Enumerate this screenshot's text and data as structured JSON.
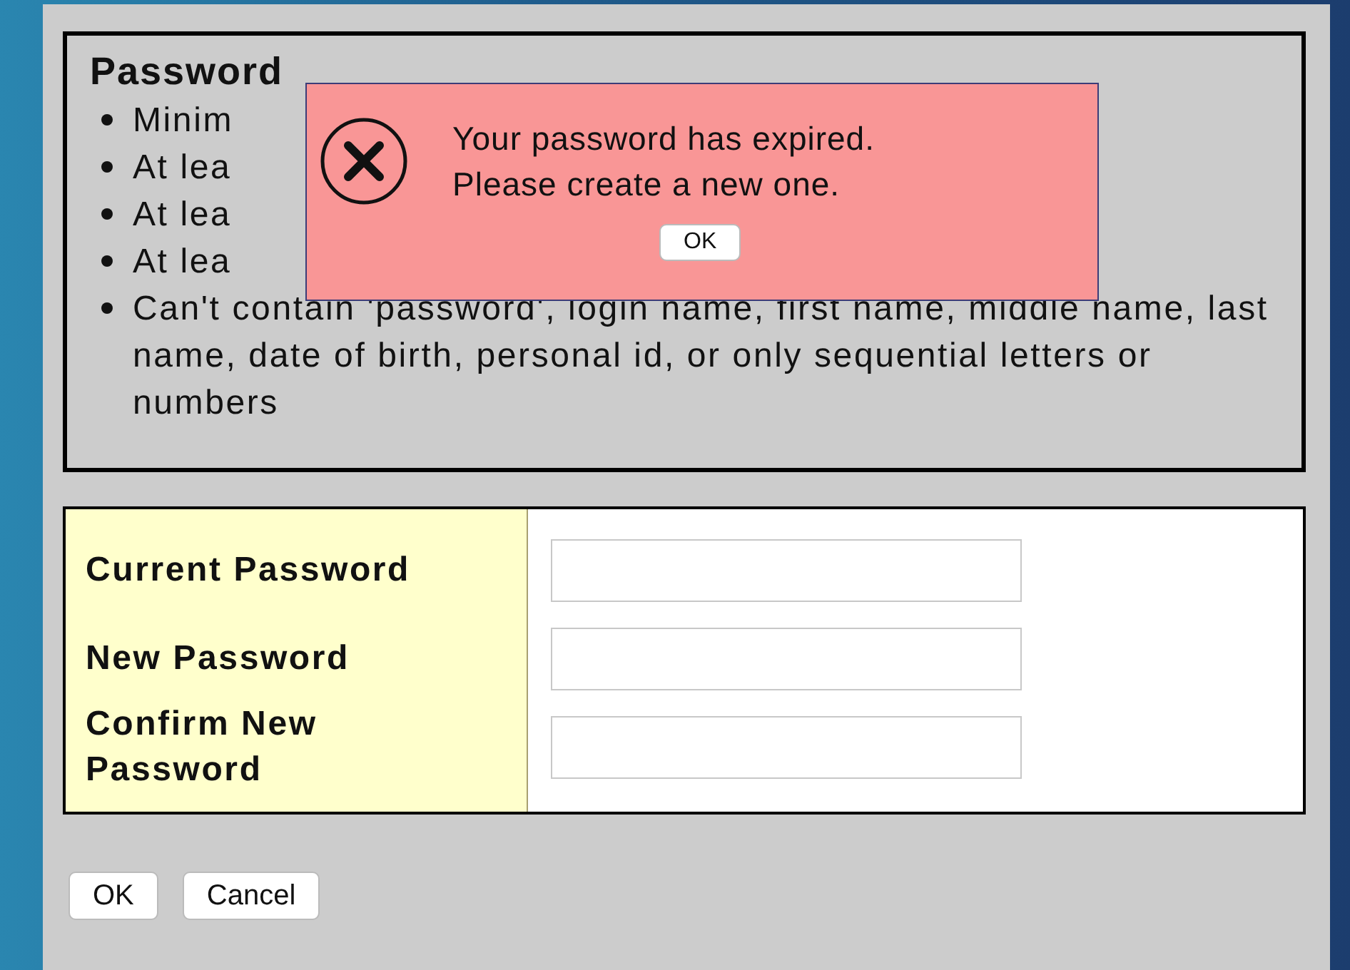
{
  "requirements": {
    "heading": "Password",
    "items": [
      "Minim",
      "At lea",
      "At lea",
      "At lea",
      "Can't contain 'password', login name, first name, middle name, last name, date of birth, personal id, or only sequential letters or numbers"
    ]
  },
  "alert": {
    "message_lines": [
      "Your password has expired.",
      "Please create a new one."
    ],
    "button": "OK"
  },
  "form": {
    "fields": [
      {
        "label": "Current Password"
      },
      {
        "label": "New Password"
      },
      {
        "label": "Confirm New Password"
      }
    ]
  },
  "buttons": [
    "OK",
    "Cancel"
  ]
}
